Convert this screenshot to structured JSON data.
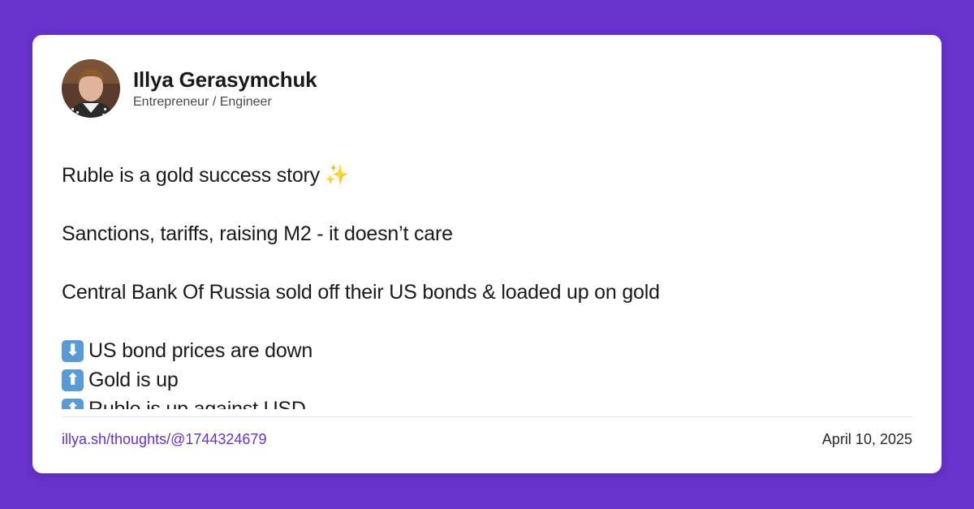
{
  "author": {
    "name": "Illya Gerasymchuk",
    "role": "Entrepreneur / Engineer"
  },
  "post": {
    "line1": "Ruble is a gold success story",
    "line1_icon": "sparkles-icon",
    "line2": "Sanctions, tariffs, raising M2 - it doesn’t care",
    "line3": "Central Bank Of Russia sold off their US bonds & loaded up on gold",
    "bullets": [
      {
        "icon": "down-arrow-icon",
        "glyph": "⬇",
        "text": "US bond prices are down"
      },
      {
        "icon": "up-arrow-icon",
        "glyph": "⬆",
        "text": "Gold is up"
      },
      {
        "icon": "up-arrow-icon",
        "glyph": "⬆",
        "text": "Ruble is up against USD"
      }
    ]
  },
  "footer": {
    "link": "illya.sh/thoughts/@1744324679",
    "date": "April 10, 2025"
  },
  "colors": {
    "background": "#6633cc",
    "link": "#6633cc",
    "emoji_box": "#5b9bd5"
  }
}
